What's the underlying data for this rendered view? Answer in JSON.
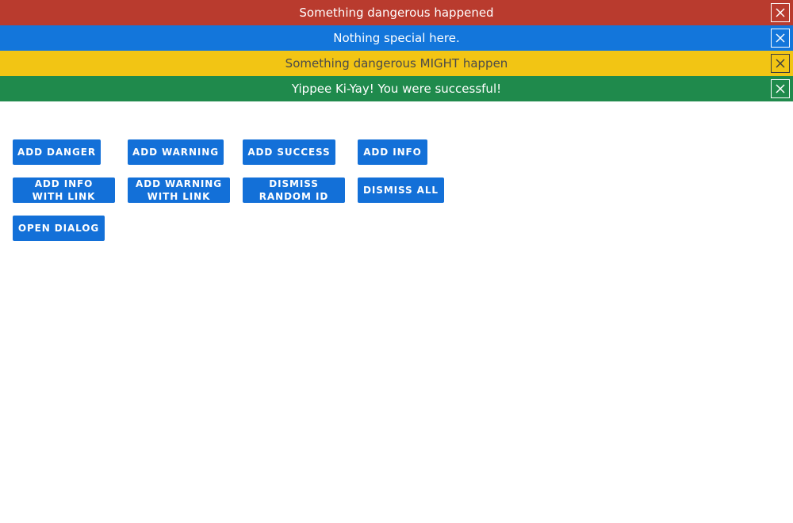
{
  "banners": [
    {
      "text": "Something dangerous happened",
      "bg": "#b93b2e",
      "fg": "#ffffff",
      "border": "#ffffff"
    },
    {
      "text": "Nothing special here.",
      "bg": "#1376db",
      "fg": "#ffffff",
      "border": "#ffffff"
    },
    {
      "text": "Something dangerous MIGHT happen",
      "bg": "#f2c514",
      "fg": "#4a4a4a",
      "border": "#3f3f3f"
    },
    {
      "text": "Yippee Ki-Yay! You were successful!",
      "bg": "#1f8a4c",
      "fg": "#ffffff",
      "border": "#ffffff"
    }
  ],
  "close_icon": "close-icon",
  "buttons": {
    "add_danger": "ADD DANGER",
    "add_warning": "ADD WARNING",
    "add_success": "ADD SUCCESS",
    "add_info": "ADD INFO",
    "add_info_with_link": "ADD INFO WITH LINK",
    "add_warning_with_link": "ADD WARNING WITH LINK",
    "dismiss_random_id": "DISMISS RANDOM ID",
    "dismiss_all": "DISMISS ALL",
    "open_dialog": "OPEN DIALOG"
  },
  "colors": {
    "button_bg": "#1370d8",
    "button_fg": "#ffffff"
  }
}
